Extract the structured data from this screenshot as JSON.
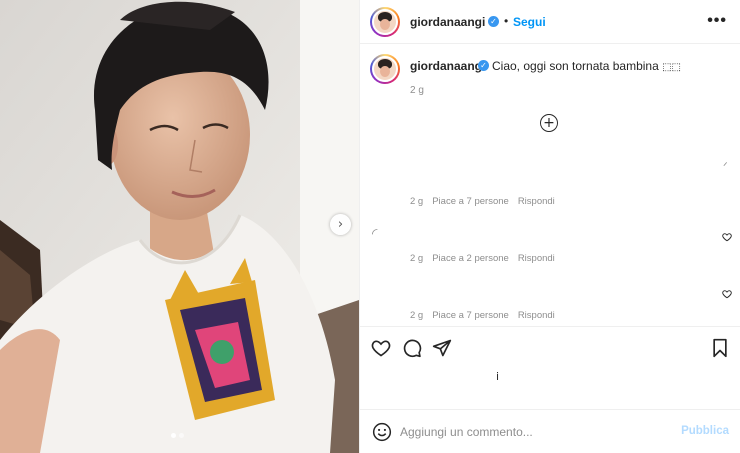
{
  "post": {
    "username": "giordanaangi",
    "separator": "•",
    "follow_label": "Segui",
    "more_label": "•••",
    "verified_mark": "✓"
  },
  "caption": {
    "username": "giordanaangi",
    "text": "Ciao, oggi son tornata bambina ",
    "emoji": "⬚⬚",
    "time": "2 g",
    "add_replies_symbol": "+"
  },
  "comments": [
    {
      "time": "2 g",
      "likes": "Piace a 7 persone",
      "reply": "Rispondi"
    },
    {
      "time": "2 g",
      "likes": "Piace a 2 persone",
      "reply": "Rispondi"
    },
    {
      "time": "2 g",
      "likes": "Piace a 7 persone",
      "reply": "Rispondi"
    }
  ],
  "carousel": {
    "next_symbol": "›",
    "slides": 2,
    "active_slide": 1
  },
  "comment_box": {
    "placeholder": "Aggiungi un commento...",
    "publish_label": "Pubblica"
  },
  "icons": {
    "like": "heart-icon",
    "comment": "comment-icon",
    "share": "share-icon",
    "save": "bookmark-icon",
    "emoji": "emoji-icon",
    "more": "more-icon"
  },
  "colors": {
    "link": "#0095f6",
    "verified": "#3897f0",
    "muted": "#8e8e8e",
    "publish_disabled": "#b3dbff"
  }
}
